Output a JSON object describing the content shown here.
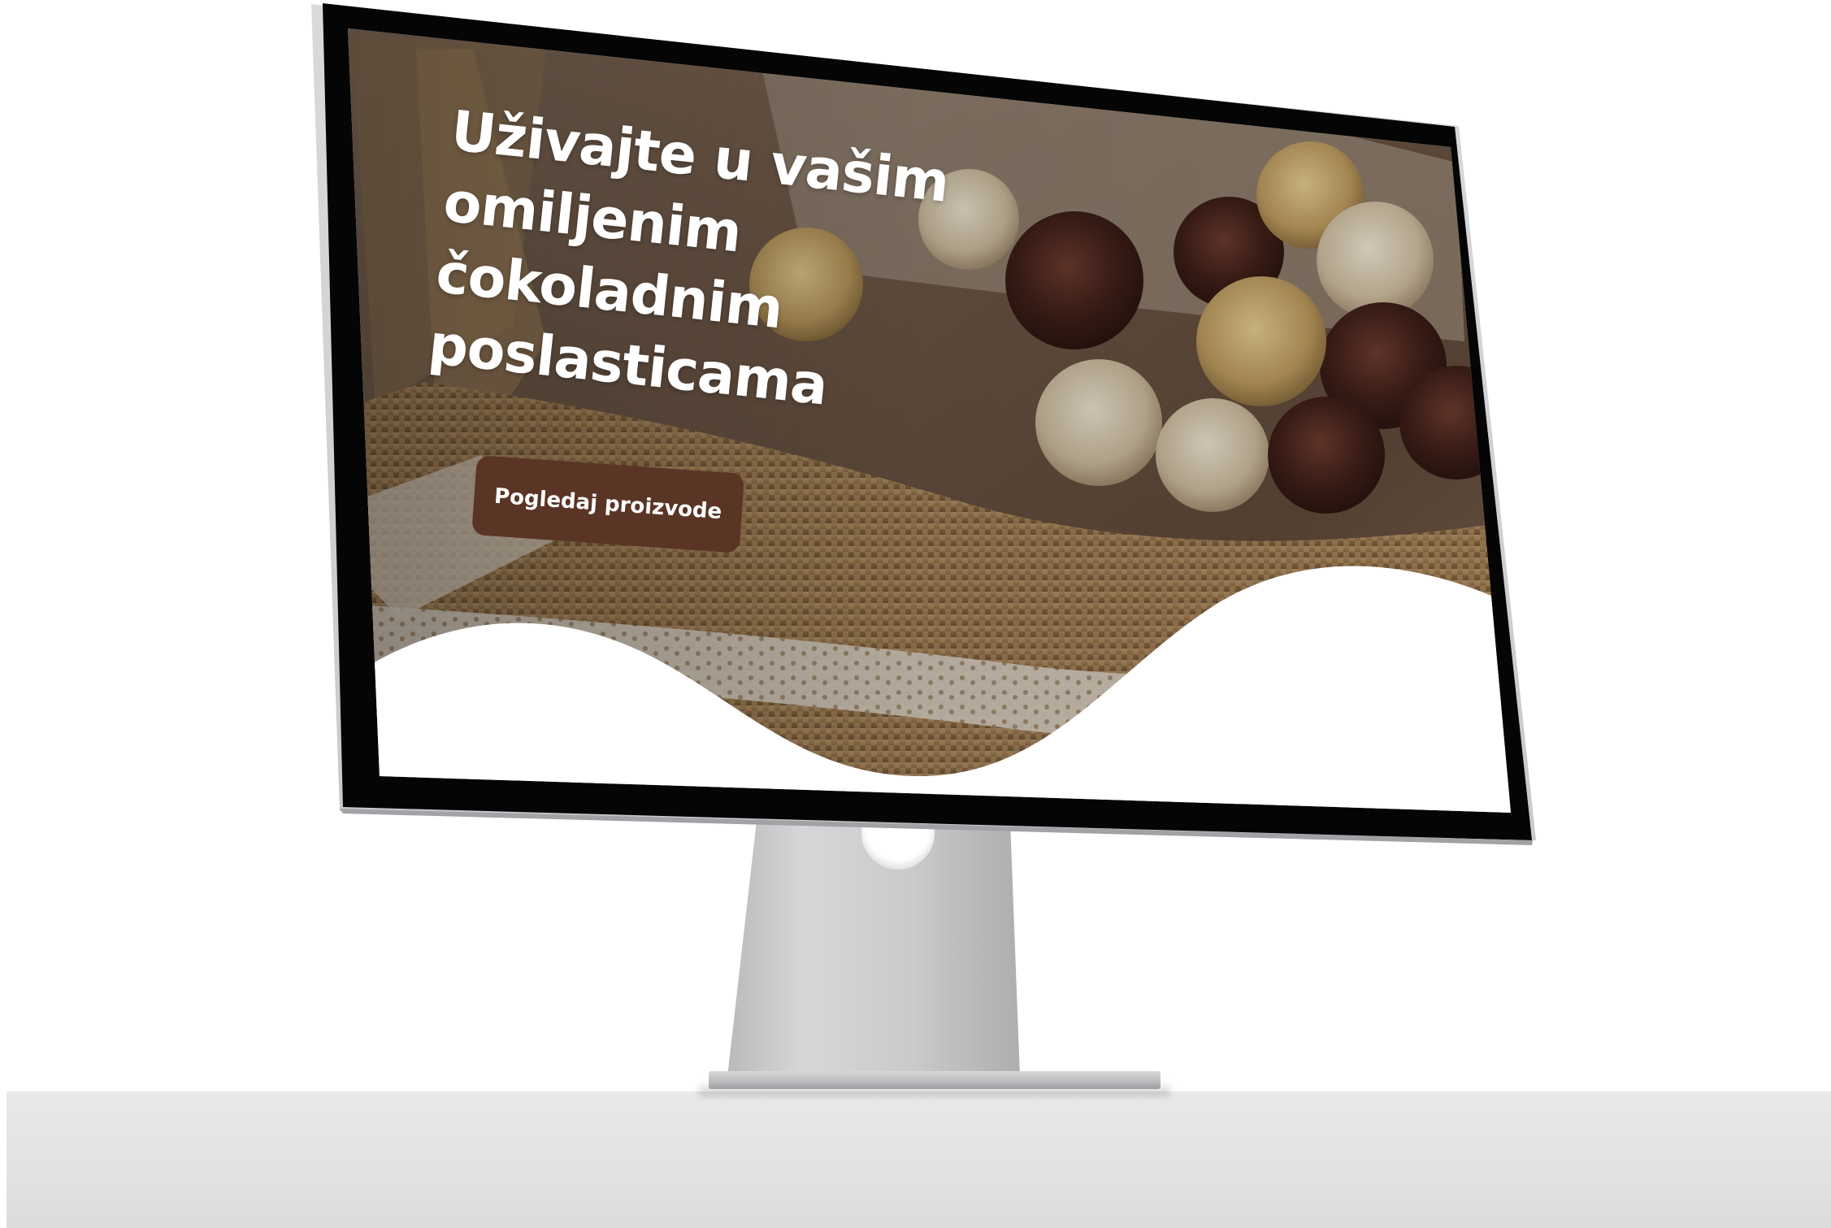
{
  "hero": {
    "title_lines": [
      "Uživajte u vašim",
      "omiljenim",
      "čokoladnim",
      "poslasticama"
    ],
    "cta_label": "Pogledaj proizvode"
  },
  "colors": {
    "cta_background": "#5a3526",
    "cta_text": "#ffffff",
    "title_text": "#ffffff",
    "page_background": "#ffffff"
  },
  "icons": {
    "device": "desktop-monitor"
  }
}
